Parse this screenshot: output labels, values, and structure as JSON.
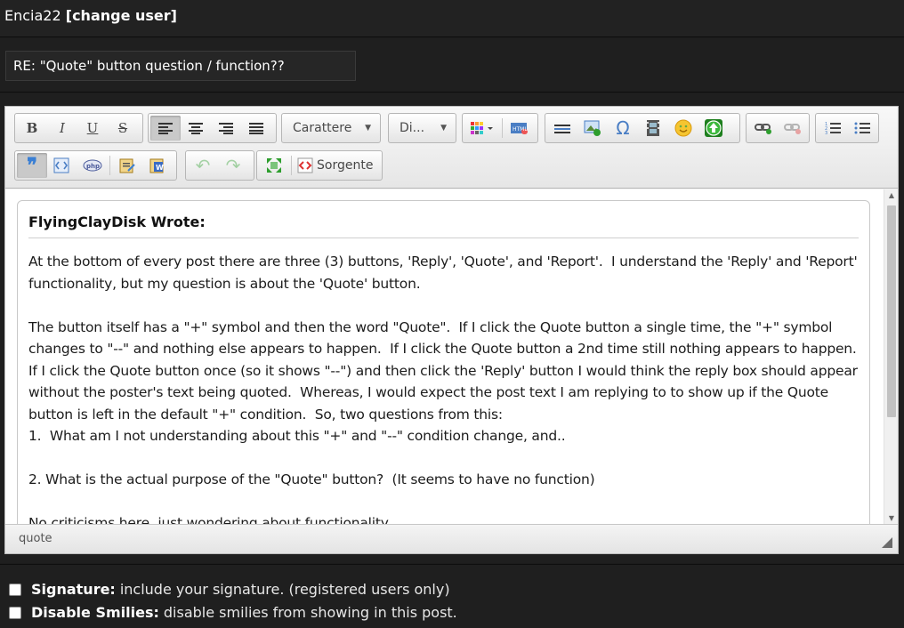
{
  "user": {
    "name": "Encia22",
    "change_label": "[change user]"
  },
  "subject": {
    "value": "RE: \"Quote\" button question / function??"
  },
  "toolbar": {
    "font_dropdown": "Carattere",
    "size_dropdown": "Di...",
    "source_label": "Sorgente",
    "buttons_row1": [
      "bold",
      "italic",
      "underline",
      "strikethrough",
      "align-left",
      "align-center",
      "align-right",
      "justify",
      "text-color",
      "color-picker",
      "horizontal-rule",
      "image",
      "special-char",
      "video",
      "smiley",
      "upload",
      "link",
      "unlink",
      "ordered-list",
      "unordered-list"
    ],
    "buttons_row2": [
      "blockquote",
      "code",
      "php",
      "paste-text",
      "paste-word",
      "undo",
      "redo",
      "maximize",
      "source"
    ]
  },
  "editor": {
    "quote_author": "FlyingClayDisk Wrote:",
    "quote_text": "At the bottom of every post there are three (3) buttons, 'Reply', 'Quote', and 'Report'.  I understand the 'Reply' and 'Report' functionality, but my question is about the 'Quote' button.\n\nThe button itself has a \"+\" symbol and then the word \"Quote\".  If I click the Quote button a single time, the \"+\" symbol changes to \"--\" and nothing else appears to happen.  If I click the Quote button a 2nd time still nothing appears to happen.  If I click the Quote button once (so it shows \"--\") and then click the 'Reply' button I would think the reply box should appear without the poster's text being quoted.  Whereas, I would expect the post text I am replying to to show up if the Quote button is left in the default \"+\" condition.  So, two questions from this:\n1.  What am I not understanding about this \"+\" and \"--\" condition change, and..\n\n2. What is the actual purpose of the \"Quote\" button?  (It seems to have no function)\n\nNo criticisms here, just wondering about functionality.",
    "status_path": "quote"
  },
  "options": {
    "signature_label": "Signature:",
    "signature_desc": "include your signature. (registered users only)",
    "smilies_label": "Disable Smilies:",
    "smilies_desc": "disable smilies from showing in this post."
  },
  "colors": {
    "page_bg": "#1c1c1c",
    "editor_bg": "#f3f3f3",
    "accent_green": "#2e9e2e"
  }
}
